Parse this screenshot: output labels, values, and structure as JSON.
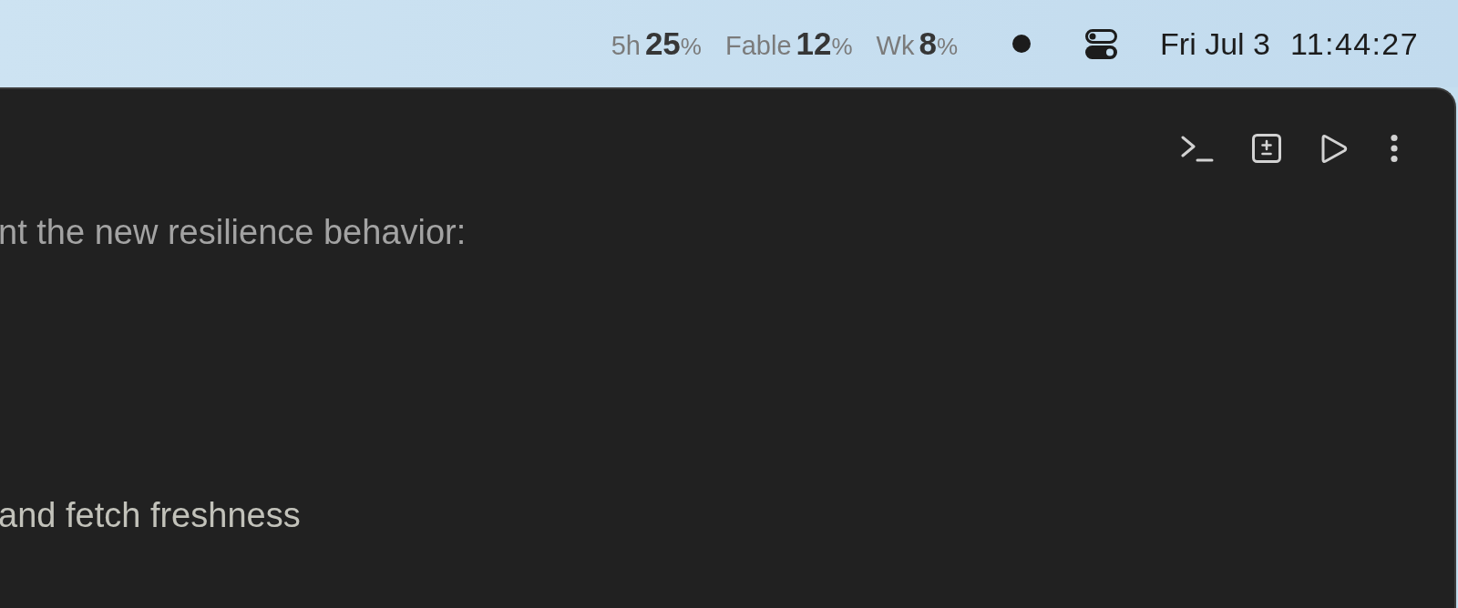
{
  "menu_bar": {
    "usage": [
      {
        "label": "5h",
        "value": "25",
        "unit": "%"
      },
      {
        "label": "Fable",
        "value": "12",
        "unit": "%"
      },
      {
        "label": "Wk",
        "value": "8",
        "unit": "%"
      }
    ],
    "date": "Fri Jul 3",
    "time": "11:44:27"
  },
  "window": {
    "lines": [
      {
        "text": "nt the new resilience behavior:",
        "dimmed": true
      },
      {
        "text": "and fetch freshness",
        "dimmed": false
      }
    ]
  }
}
